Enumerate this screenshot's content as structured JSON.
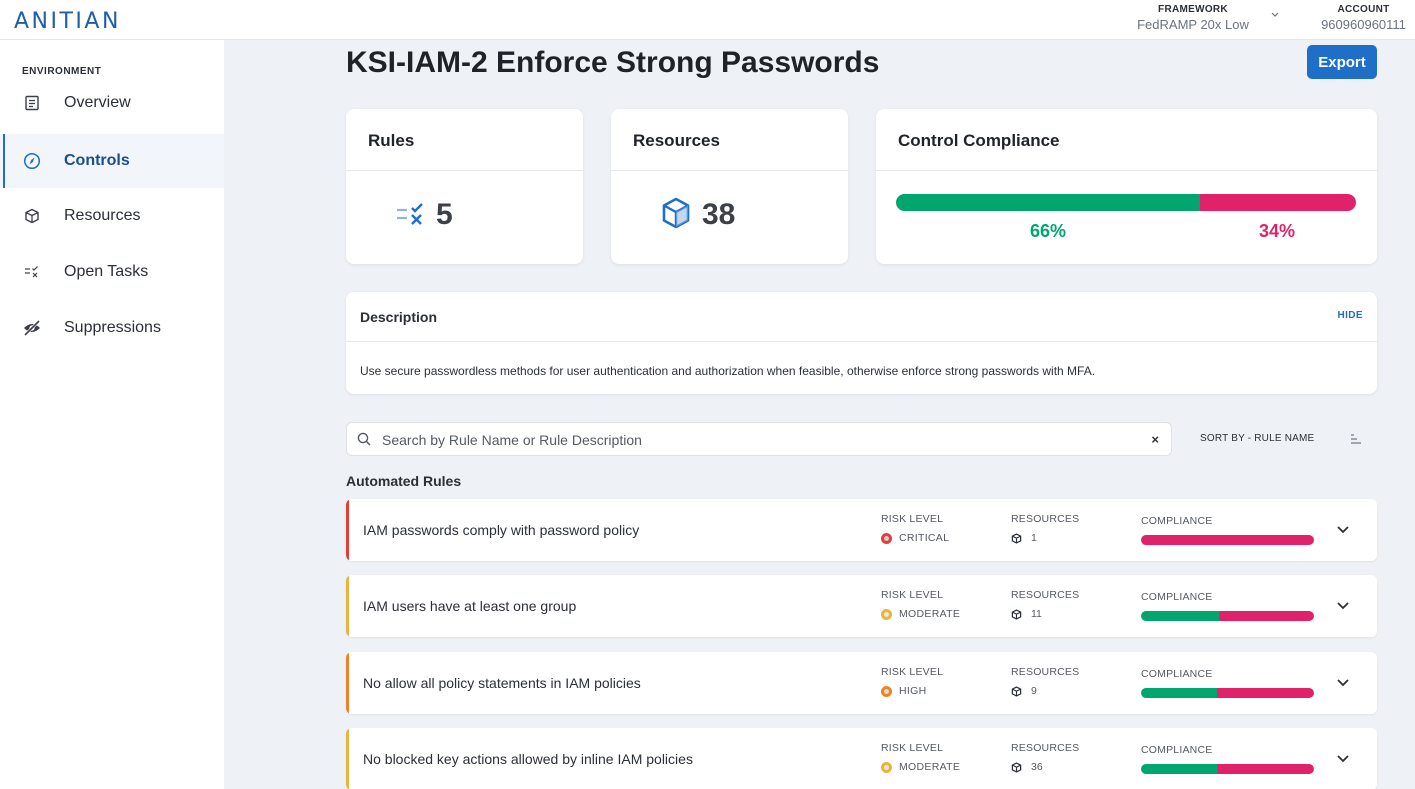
{
  "brand": {
    "logo_text": "ANITIAN"
  },
  "header": {
    "framework_label": "FRAMEWORK",
    "framework_value": "FedRAMP 20x Low",
    "account_label": "ACCOUNT",
    "account_value": "960960960111"
  },
  "sidebar": {
    "section_label": "ENVIRONMENT",
    "items": [
      {
        "label": "Overview",
        "icon": "document-icon",
        "active": false
      },
      {
        "label": "Controls",
        "icon": "compass-icon",
        "active": true
      },
      {
        "label": "Resources",
        "icon": "cube-icon",
        "active": false
      },
      {
        "label": "Open Tasks",
        "icon": "tasks-icon",
        "active": false
      },
      {
        "label": "Suppressions",
        "icon": "eye-off-icon",
        "active": false
      }
    ]
  },
  "page": {
    "title": "KSI-IAM-2 Enforce Strong Passwords",
    "export_label": "Export"
  },
  "stats": {
    "rules": {
      "title": "Rules",
      "value": "5"
    },
    "resources": {
      "title": "Resources",
      "value": "38"
    },
    "compliance": {
      "title": "Control Compliance",
      "pass_fraction": 0.66,
      "pass_label": "66%",
      "fail_label": "34%"
    }
  },
  "description": {
    "title": "Description",
    "hide_label": "HIDE",
    "text": "Use secure passwordless methods for user authentication and authorization when feasible, otherwise enforce strong passwords with MFA."
  },
  "search": {
    "placeholder": "Search by Rule Name or Rule Description",
    "value": "",
    "clear_glyph": "×",
    "sort_label": "SORT BY - RULE NAME"
  },
  "rules_section": {
    "title": "Automated Rules",
    "col_risk": "RISK LEVEL",
    "col_resources": "RESOURCES",
    "col_compliance": "COMPLIANCE"
  },
  "rules": [
    {
      "name": "IAM passwords comply with password policy",
      "risk": "CRITICAL",
      "resources": "1",
      "compliance_fraction": 0.0
    },
    {
      "name": "IAM users have at least one group",
      "risk": "MODERATE",
      "resources": "11",
      "compliance_fraction": 0.45
    },
    {
      "name": "No allow all policy statements in IAM policies",
      "risk": "HIGH",
      "resources": "9",
      "compliance_fraction": 0.44
    },
    {
      "name": "No blocked key actions allowed by inline IAM policies",
      "risk": "MODERATE",
      "resources": "36",
      "compliance_fraction": 0.44
    }
  ],
  "colors": {
    "brand_blue": "#1f6fc8",
    "pass_green": "#00a66e",
    "fail_red": "#e0226a",
    "risk_critical": "#e0403a",
    "risk_high": "#e8852c",
    "risk_moderate": "#e8b440"
  }
}
